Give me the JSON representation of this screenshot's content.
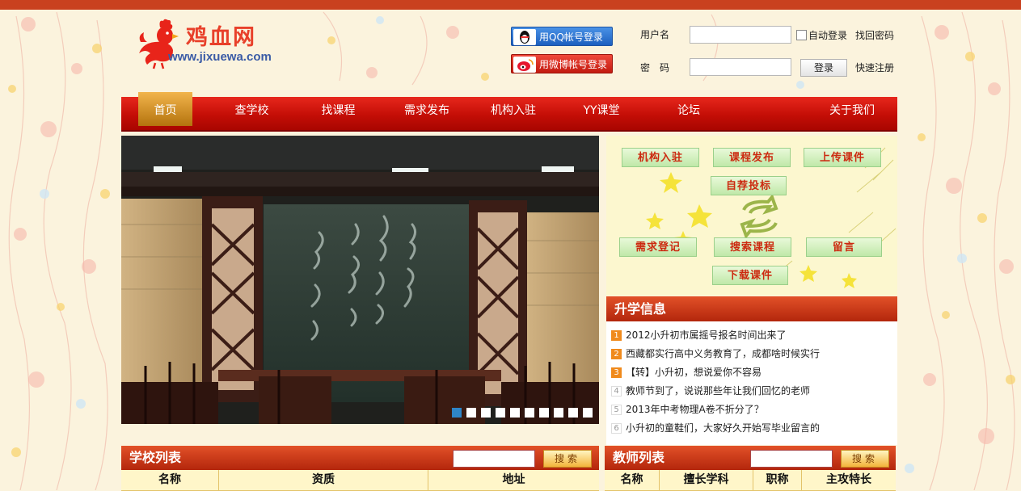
{
  "site": {
    "name_cn": "鸡血网",
    "url": "www.jixuewa.com"
  },
  "social": {
    "qq_label": "用QQ帐号登录",
    "weibo_label": "用微博帐号登录"
  },
  "login": {
    "username_label": "用户名",
    "password_label": "密　码",
    "auto_login_label": "自动登录",
    "forgot_label": "找回密码",
    "submit_label": "登录",
    "register_label": "快速注册",
    "username_value": "",
    "password_value": ""
  },
  "nav": {
    "items": [
      {
        "label": "首页",
        "active": true
      },
      {
        "label": "查学校"
      },
      {
        "label": "找课程"
      },
      {
        "label": "需求发布"
      },
      {
        "label": "机构入驻"
      },
      {
        "label": "YY课堂"
      },
      {
        "label": "论坛"
      },
      {
        "label": "关于我们"
      }
    ]
  },
  "carousel": {
    "slide_count": 10,
    "active_index": 0
  },
  "quick_links": [
    "机构入驻",
    "课程发布",
    "上传课件",
    "自荐投标",
    "需求登记",
    "搜索课程",
    "留言",
    "下载课件"
  ],
  "news": {
    "title": "升学信息",
    "items": [
      {
        "num": "1",
        "text": "2012小升初市属摇号报名时间出来了"
      },
      {
        "num": "2",
        "text": "西藏都实行高中义务教育了，成都啥时候实行"
      },
      {
        "num": "3",
        "text": "【转】小升初，想说爱你不容易"
      },
      {
        "num": "4",
        "text": "教师节到了，说说那些年让我们回忆的老师"
      },
      {
        "num": "5",
        "text": "2013年中考物理A卷不折分了？"
      },
      {
        "num": "6",
        "text": "小升初的童鞋们，大家好久开始写毕业留言的"
      }
    ]
  },
  "school_list": {
    "title": "学校列表",
    "search_label": "搜索",
    "search_value": "",
    "columns": [
      "名称",
      "资质",
      "地址"
    ]
  },
  "teacher_list": {
    "title": "教师列表",
    "search_label": "搜索",
    "search_value": "",
    "columns": [
      "名称",
      "擅长学科",
      "职称",
      "主攻特长"
    ]
  },
  "colors": {
    "brand_red": "#c40e06",
    "nav_active": "#d99a2b",
    "header_red": "#c9411f",
    "accent_blue": "#2e85c7"
  }
}
